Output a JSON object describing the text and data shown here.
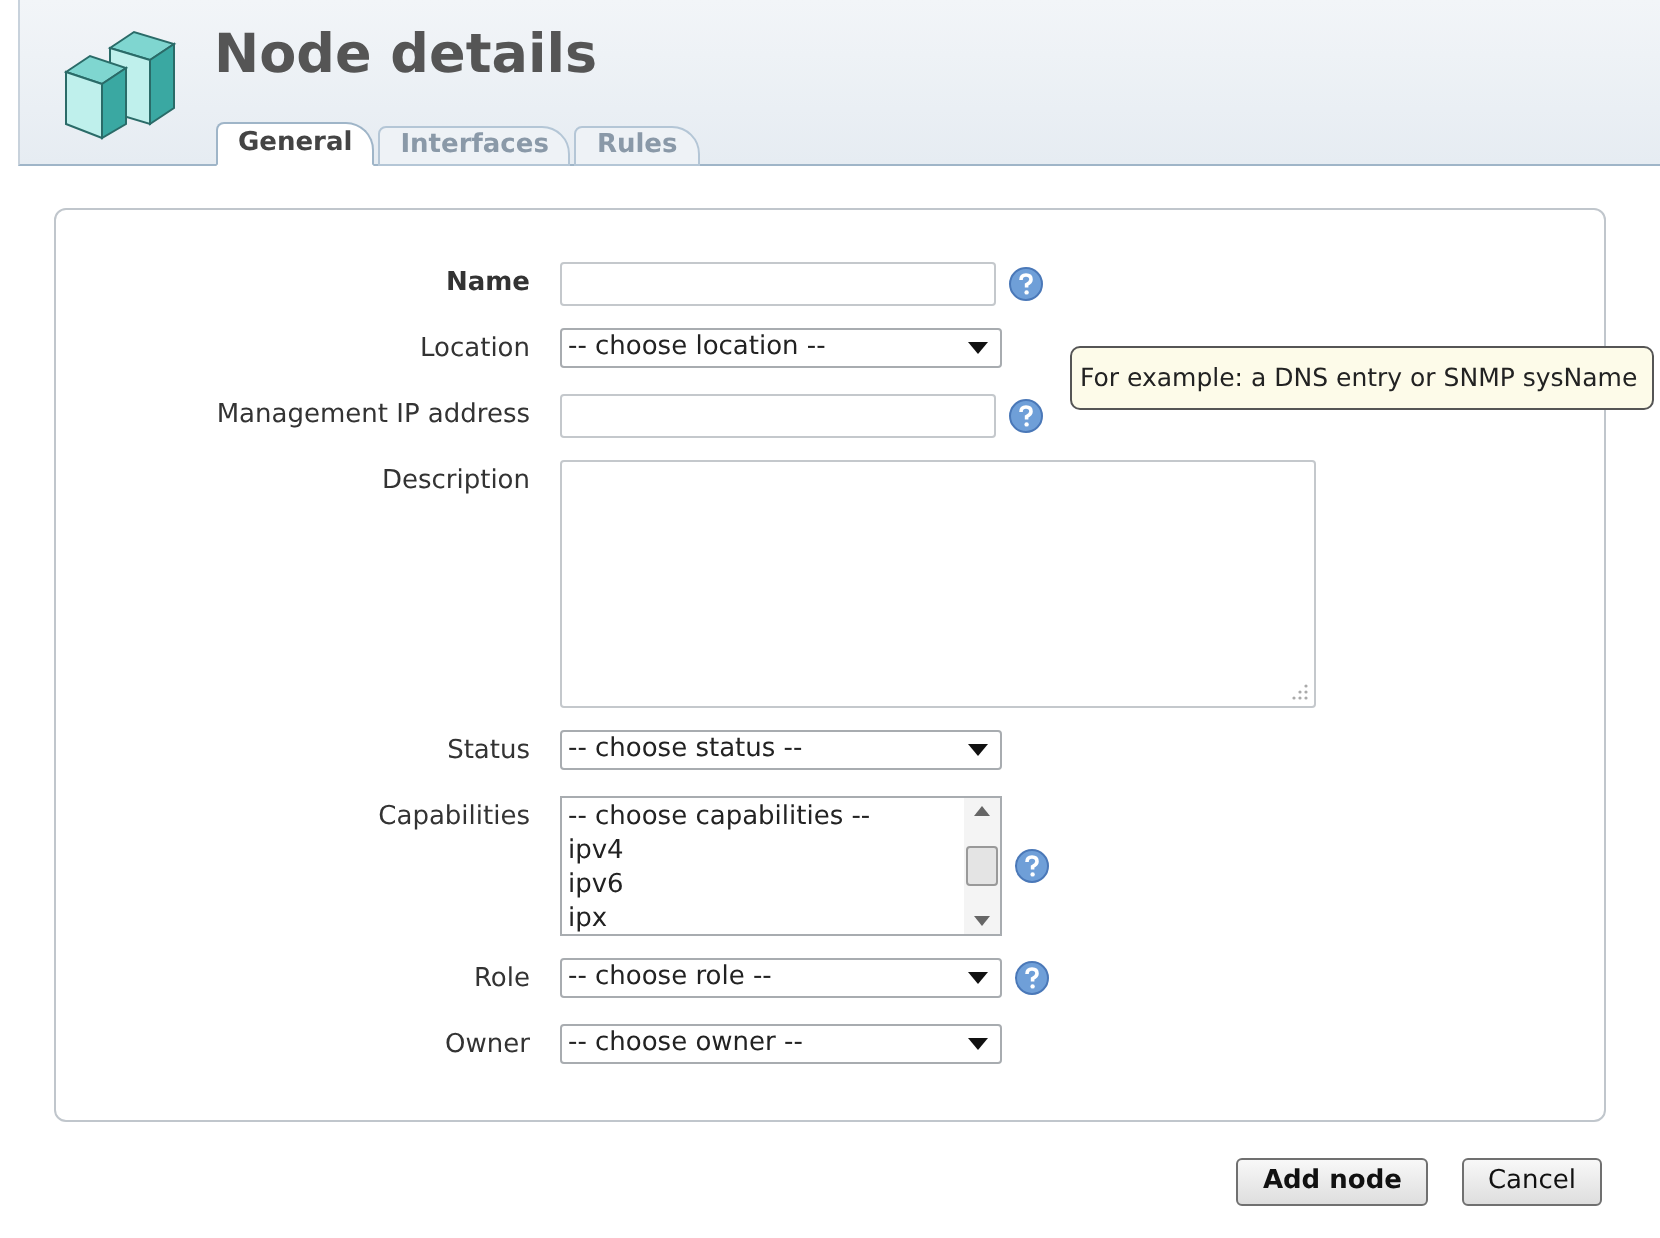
{
  "header": {
    "title": "Node details"
  },
  "tabs": [
    {
      "label": "General",
      "selected": true
    },
    {
      "label": "Interfaces",
      "selected": false
    },
    {
      "label": "Rules",
      "selected": false
    }
  ],
  "fields": [
    {
      "kind": "text",
      "label": "Name",
      "required": true,
      "help": true
    },
    {
      "kind": "select",
      "label": "Location",
      "required": false,
      "help": false,
      "value": "-- choose location --"
    },
    {
      "kind": "text",
      "label": "Management IP address",
      "required": false,
      "help": true
    },
    {
      "kind": "textarea",
      "label": "Description",
      "required": false,
      "help": false
    },
    {
      "kind": "select",
      "label": "Status",
      "required": false,
      "help": false,
      "value": "-- choose status --"
    },
    {
      "kind": "listbox",
      "label": "Capabilities",
      "required": false,
      "help": true,
      "options": [
        "-- choose capabilities --",
        "ipv4",
        "ipv6",
        "ipx"
      ]
    },
    {
      "kind": "select",
      "label": "Role",
      "required": false,
      "help": true,
      "value": "-- choose role --"
    },
    {
      "kind": "select",
      "label": "Owner",
      "required": false,
      "help": false,
      "value": "-- choose owner --"
    }
  ],
  "tooltip": "For example: a DNS entry or SNMP sysName",
  "buttons": [
    {
      "label": "Add node",
      "primary": true
    },
    {
      "label": "Cancel",
      "primary": false
    }
  ]
}
